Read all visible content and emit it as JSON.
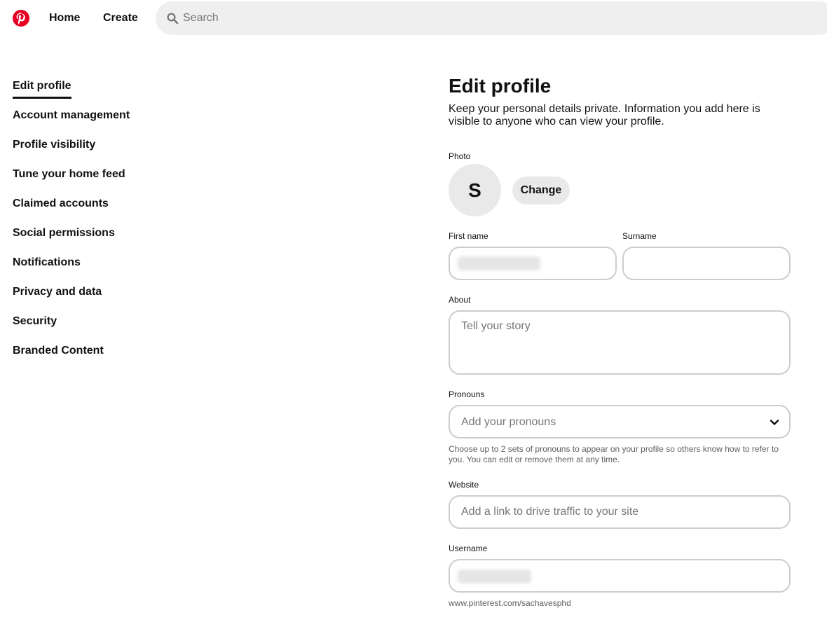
{
  "header": {
    "logo_icon": "pinterest-logo-icon",
    "brand_color": "#e60023",
    "nav": {
      "home_label": "Home",
      "create_label": "Create"
    },
    "search": {
      "icon": "search-icon",
      "placeholder": "Search",
      "value": ""
    }
  },
  "sidebar": {
    "items": [
      {
        "label": "Edit profile",
        "active": true
      },
      {
        "label": "Account management"
      },
      {
        "label": "Profile visibility"
      },
      {
        "label": "Tune your home feed"
      },
      {
        "label": "Claimed accounts"
      },
      {
        "label": "Social permissions"
      },
      {
        "label": "Notifications"
      },
      {
        "label": "Privacy and data"
      },
      {
        "label": "Security"
      },
      {
        "label": "Branded Content"
      }
    ]
  },
  "main": {
    "title": "Edit profile",
    "description": "Keep your personal details private. Information you add here is visible to anyone who can view your profile.",
    "photo": {
      "label": "Photo",
      "avatar_initial": "S",
      "change_label": "Change"
    },
    "first_name": {
      "label": "First name",
      "value": "",
      "redacted": true
    },
    "surname": {
      "label": "Surname",
      "value": ""
    },
    "about": {
      "label": "About",
      "placeholder": "Tell your story",
      "value": ""
    },
    "pronouns": {
      "label": "Pronouns",
      "placeholder": "Add your pronouns",
      "icon": "chevron-down-icon",
      "help": "Choose up to 2 sets of pronouns to appear on your profile so others know how to refer to you. You can edit or remove them at any time."
    },
    "website": {
      "label": "Website",
      "placeholder": "Add a link to drive traffic to your site",
      "value": ""
    },
    "username": {
      "label": "Username",
      "value": "",
      "redacted": true,
      "profile_url": "www.pinterest.com/sachavesphd"
    }
  }
}
